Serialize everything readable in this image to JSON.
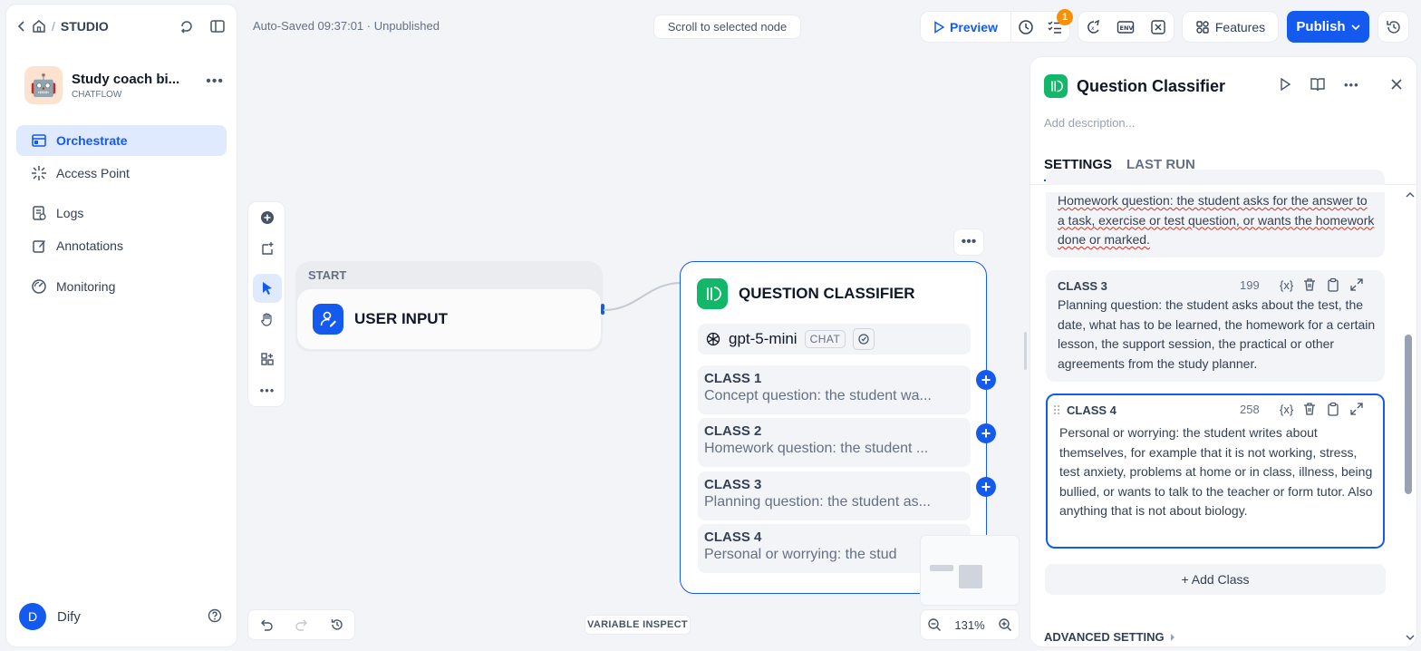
{
  "app": {
    "breadcrumb_studio": "STUDIO",
    "name": "Study coach bi...",
    "mode": "CHATFLOW",
    "avatar_emoji": "🤖"
  },
  "sidebar": {
    "items": [
      {
        "label": "Orchestrate",
        "icon": "orchestrate-icon",
        "active": true
      },
      {
        "label": "Access Point",
        "icon": "access-point-icon"
      },
      {
        "label": "Logs",
        "icon": "logs-icon"
      },
      {
        "label": "Annotations",
        "icon": "annotations-icon"
      },
      {
        "label": "Monitoring",
        "icon": "monitoring-icon"
      }
    ],
    "user": {
      "initial": "D",
      "name": "Dify"
    }
  },
  "topbar": {
    "autosave": "Auto-Saved 09:37:01 · Unpublished",
    "scroll_to_node": "Scroll to selected node",
    "preview": "Preview",
    "checklist_badge": "1",
    "features": "Features",
    "publish": "Publish"
  },
  "canvas": {
    "start_label": "START",
    "user_input": "USER INPUT",
    "classifier_title": "QUESTION CLASSIFIER",
    "model": "gpt-5-mini",
    "model_tag": "CHAT",
    "classes": [
      {
        "name": "CLASS 1",
        "preview": "Concept question: the student wa..."
      },
      {
        "name": "CLASS 2",
        "preview": "Homework question: the student ..."
      },
      {
        "name": "CLASS 3",
        "preview": "Planning question: the student as..."
      },
      {
        "name": "CLASS 4",
        "preview": "Personal or worrying: the stud"
      }
    ],
    "zoom": "131%",
    "variable_inspect": "VARIABLE INSPECT"
  },
  "panel": {
    "title": "Question Classifier",
    "description_placeholder": "Add description...",
    "tabs": [
      "SETTINGS",
      "LAST RUN"
    ],
    "class2_text": "Homework question: the student asks for the answer to a task, exercise or test question, or wants the homework done or marked.",
    "class3": {
      "name": "CLASS 3",
      "count": "199",
      "text": "Planning question: the student asks about the test, the date, what has to be learned, the homework for a certain lesson, the support session, the practical or other agreements from the study planner."
    },
    "class4": {
      "name": "CLASS 4",
      "count": "258",
      "text": "Personal or worrying: the student writes about themselves, for example that it is not working, stress, test anxiety, problems at home or in class, illness, being bullied, or wants to talk to the teacher or form tutor. Also anything that is not about biology."
    },
    "var_token": "{x}",
    "add_class": "+ Add Class",
    "advanced_setting": "ADVANCED SETTING"
  },
  "colors": {
    "accent": "#155aef",
    "classifier_green": "#12b76a",
    "badge_orange": "#f79009"
  }
}
